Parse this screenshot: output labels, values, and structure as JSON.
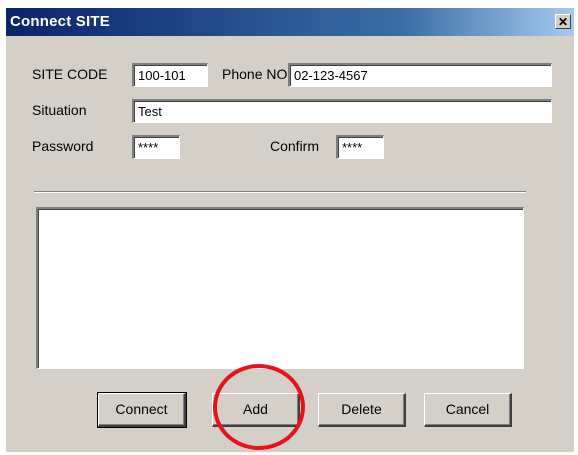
{
  "window": {
    "title": "Connect SITE",
    "close_glyph": "✕"
  },
  "form": {
    "site_code_label": "SITE CODE",
    "site_code_value": "100-101",
    "phone_label": "Phone NO",
    "phone_value": "02-123-4567",
    "situation_label": "Situation",
    "situation_value": "Test",
    "password_label": "Password",
    "password_value": "****",
    "confirm_label": "Confirm",
    "confirm_value": "****"
  },
  "buttons": {
    "connect": "Connect",
    "add": "Add",
    "delete": "Delete",
    "cancel": "Cancel"
  },
  "annotation": {
    "highlight_color": "#e8121c",
    "target": "add-button"
  }
}
